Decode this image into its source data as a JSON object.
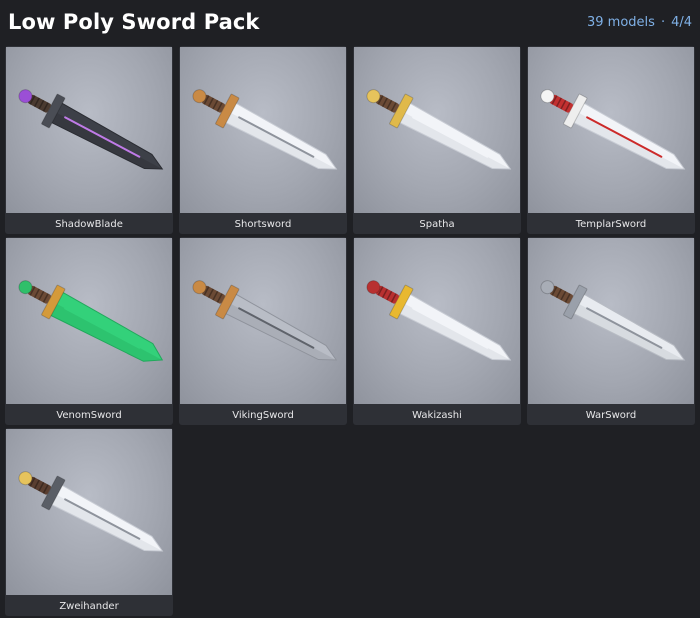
{
  "header": {
    "title": "Low Poly Sword Pack",
    "count": "39 models",
    "separator": "·",
    "page": "4/4"
  },
  "items": [
    {
      "name": "ShadowBlade",
      "icon": "shadowblade-sword-icon",
      "blade": "#3d4048",
      "bladeEdge": "#2a2c32",
      "fuller": "#c07be8",
      "guard": "#4a4d55",
      "grip": "#4a3a30",
      "pommel": "#9b4fd6"
    },
    {
      "name": "Shortsword",
      "icon": "shortsword-icon",
      "blade": "#f2f4f8",
      "bladeEdge": "#c8ccd4",
      "fuller": "#8e939c",
      "guard": "#c98a45",
      "grip": "#6b4a35",
      "pommel": "#c98a45"
    },
    {
      "name": "Spatha",
      "icon": "spatha-sword-icon",
      "blade": "#f2f4f8",
      "bladeEdge": "#c8ccd4",
      "fuller": "#f2f4f8",
      "guard": "#e0b94a",
      "grip": "#6b4a35",
      "pommel": "#e6c35c"
    },
    {
      "name": "TemplarSword",
      "icon": "templar-sword-icon",
      "blade": "#f2f4f8",
      "bladeEdge": "#c8ccd4",
      "fuller": "#cc2a2a",
      "guard": "#eeeeee",
      "grip": "#c23030",
      "pommel": "#f4f4f4"
    },
    {
      "name": "VenomSword",
      "icon": "venom-sword-icon",
      "blade": "#33d17a",
      "bladeEdge": "#22a85c",
      "fuller": "#33d17a",
      "guard": "#d49a3a",
      "grip": "#6b4a35",
      "pommel": "#2fbf6a"
    },
    {
      "name": "VikingSword",
      "icon": "viking-sword-icon",
      "blade": "#b9bdc6",
      "bladeEdge": "#8f939c",
      "fuller": "#5f636b",
      "guard": "#c98a45",
      "grip": "#6b4a35",
      "pommel": "#c98a45"
    },
    {
      "name": "Wakizashi",
      "icon": "wakizashi-sword-icon",
      "blade": "#f2f4f8",
      "bladeEdge": "#c8ccd4",
      "fuller": "#f2f4f8",
      "guard": "#e8b830",
      "grip": "#b83030",
      "pommel": "#b83030"
    },
    {
      "name": "WarSword",
      "icon": "warsword-icon",
      "blade": "#e8ebf0",
      "bladeEdge": "#b8bcc4",
      "fuller": "#8e939c",
      "guard": "#9aa0aa",
      "grip": "#6b4a35",
      "pommel": "#a8adb6"
    },
    {
      "name": "Zweihander",
      "icon": "zweihander-sword-icon",
      "blade": "#f2f4f8",
      "bladeEdge": "#c8ccd4",
      "fuller": "#8e939c",
      "guard": "#5a5e66",
      "grip": "#5a3e30",
      "pommel": "#e6c35c"
    }
  ]
}
